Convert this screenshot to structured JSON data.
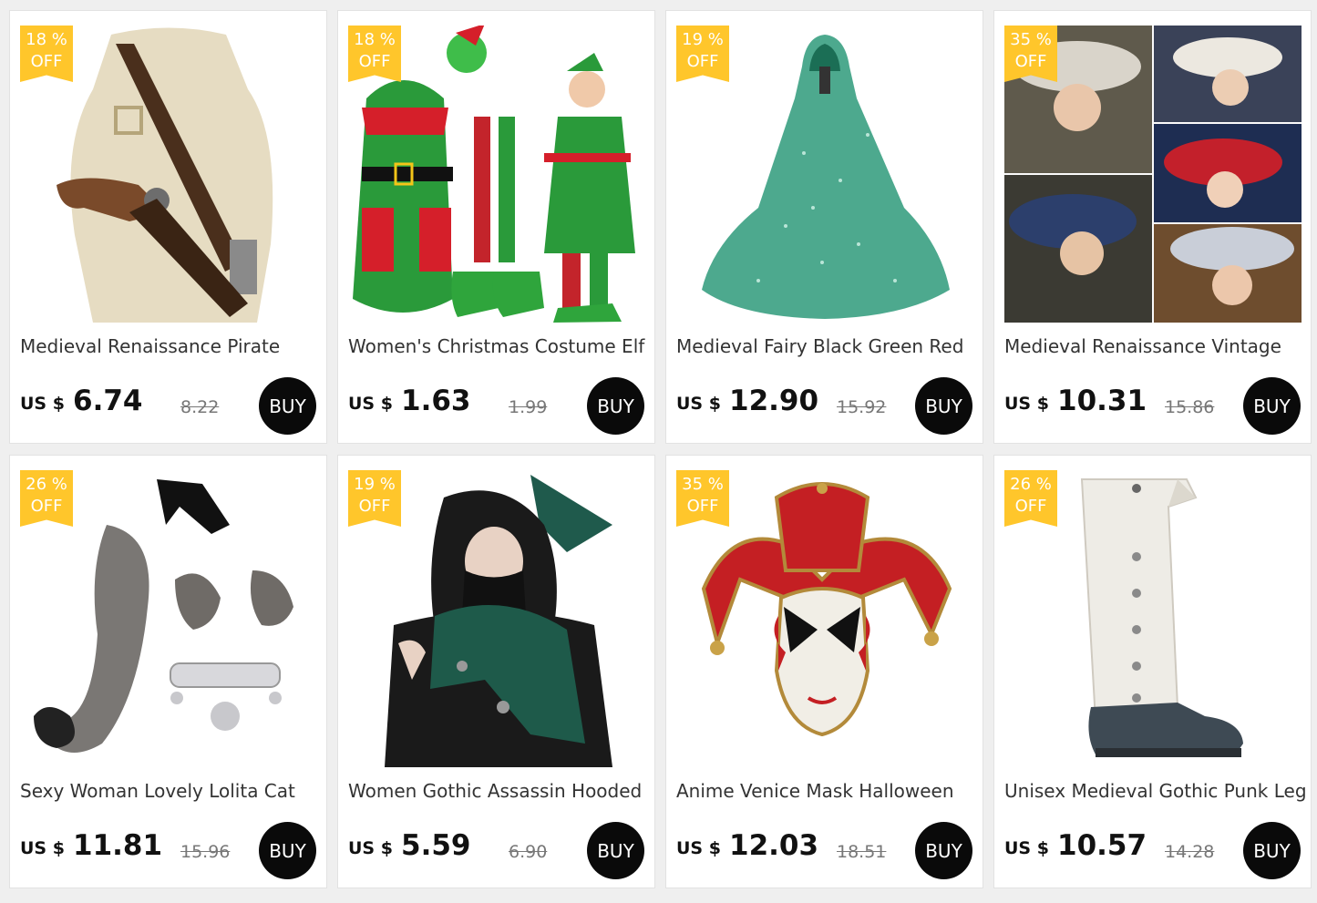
{
  "products": [
    {
      "discount_value": "18 %",
      "discount_off": "OFF",
      "title": "Medieval Renaissance Pirate",
      "currency": "US $",
      "price": "6.74",
      "original_price": "8.22",
      "buy_label": "BUY",
      "image": "pirate-holster-image"
    },
    {
      "discount_value": "18 %",
      "discount_off": "OFF",
      "title": "Women's Christmas Costume Elf",
      "currency": "US $",
      "price": "1.63",
      "original_price": "1.99",
      "buy_label": "BUY",
      "image": "elf-costume-image"
    },
    {
      "discount_value": "19 %",
      "discount_off": "OFF",
      "title": "Medieval Fairy Black Green Red",
      "currency": "US $",
      "price": "12.90",
      "original_price": "15.92",
      "buy_label": "BUY",
      "image": "green-cape-image"
    },
    {
      "discount_value": "35 %",
      "discount_off": "OFF",
      "title": "Medieval Renaissance Vintage",
      "currency": "US $",
      "price": "10.31",
      "original_price": "15.86",
      "buy_label": "BUY",
      "image": "vintage-hats-image"
    },
    {
      "discount_value": "26 %",
      "discount_off": "OFF",
      "title": "Sexy Woman Lovely Lolita Cat",
      "currency": "US $",
      "price": "11.81",
      "original_price": "15.96",
      "buy_label": "BUY",
      "image": "cat-tail-ears-image"
    },
    {
      "discount_value": "19 %",
      "discount_off": "OFF",
      "title": "Women Gothic Assassin Hooded",
      "currency": "US $",
      "price": "5.59",
      "original_price": "6.90",
      "buy_label": "BUY",
      "image": "hooded-scarf-image"
    },
    {
      "discount_value": "35 %",
      "discount_off": "OFF",
      "title": "Anime Venice Mask Halloween",
      "currency": "US $",
      "price": "12.03",
      "original_price": "18.51",
      "buy_label": "BUY",
      "image": "jester-mask-image"
    },
    {
      "discount_value": "26 %",
      "discount_off": "OFF",
      "title": "Unisex Medieval Gothic Punk Leg",
      "currency": "US $",
      "price": "10.57",
      "original_price": "14.28",
      "buy_label": "BUY",
      "image": "boot-cover-image"
    }
  ],
  "colors": {
    "badge": "#ffc62b",
    "buy_button": "#0a0a0a",
    "page_background": "#efefef"
  }
}
